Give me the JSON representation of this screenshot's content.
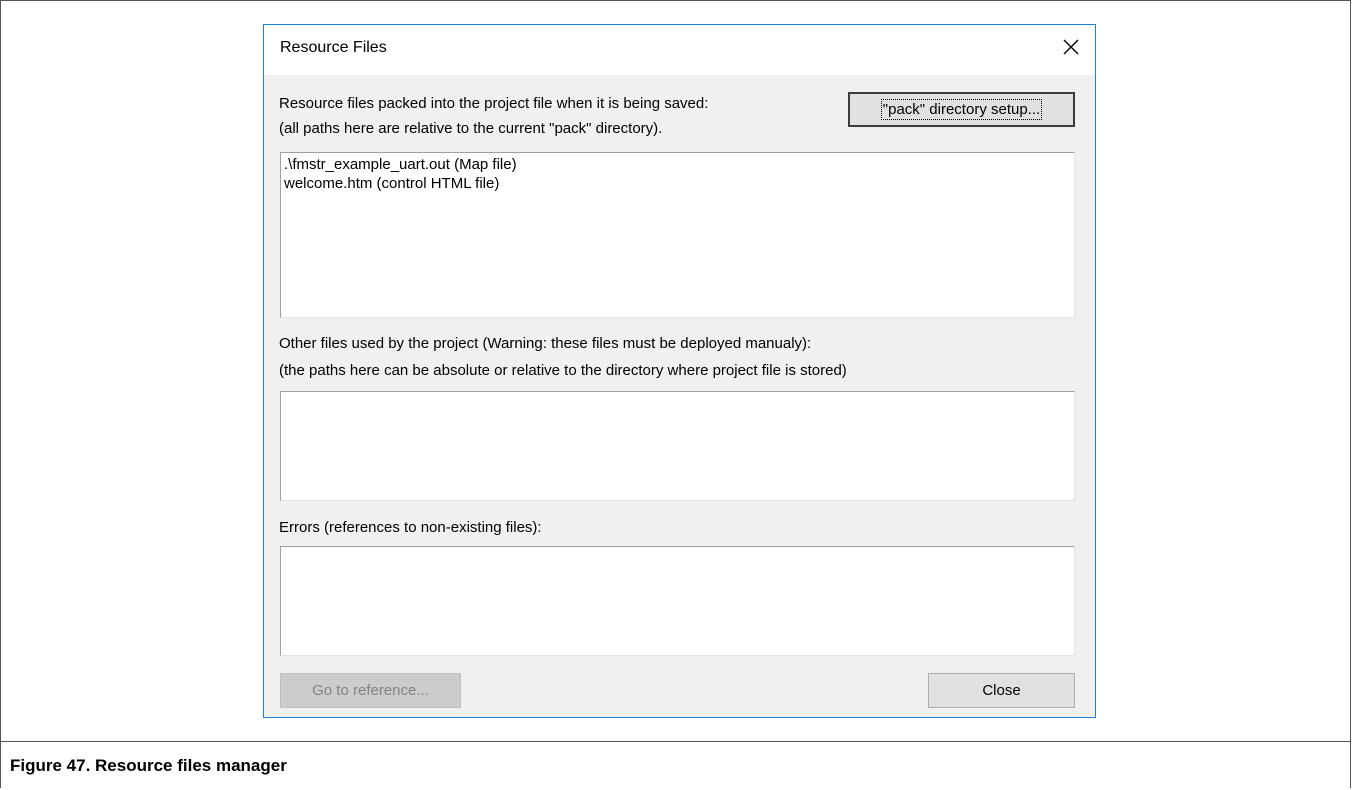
{
  "dialog": {
    "title": "Resource Files",
    "close_icon": "close-icon"
  },
  "packed_section": {
    "label_line1": "Resource files packed into the project file when it is being saved:",
    "label_line2": "(all paths here are relative to the current \"pack\" directory).",
    "pack_button_label": "\"pack\" directory setup...",
    "files": [
      ".\\fmstr_example_uart.out (Map file)",
      "welcome.htm (control HTML file)"
    ]
  },
  "other_section": {
    "label_line1": "Other files used by the project (Warning: these files must be deployed manualy):",
    "label_line2": "(the paths here can be absolute or relative to the directory where project file is stored)",
    "files": []
  },
  "errors_section": {
    "label": "Errors (references to non-existing files):",
    "files": []
  },
  "buttons": {
    "go_to_reference": "Go to reference...",
    "close": "Close"
  },
  "caption": "Figure 47. Resource files manager"
}
